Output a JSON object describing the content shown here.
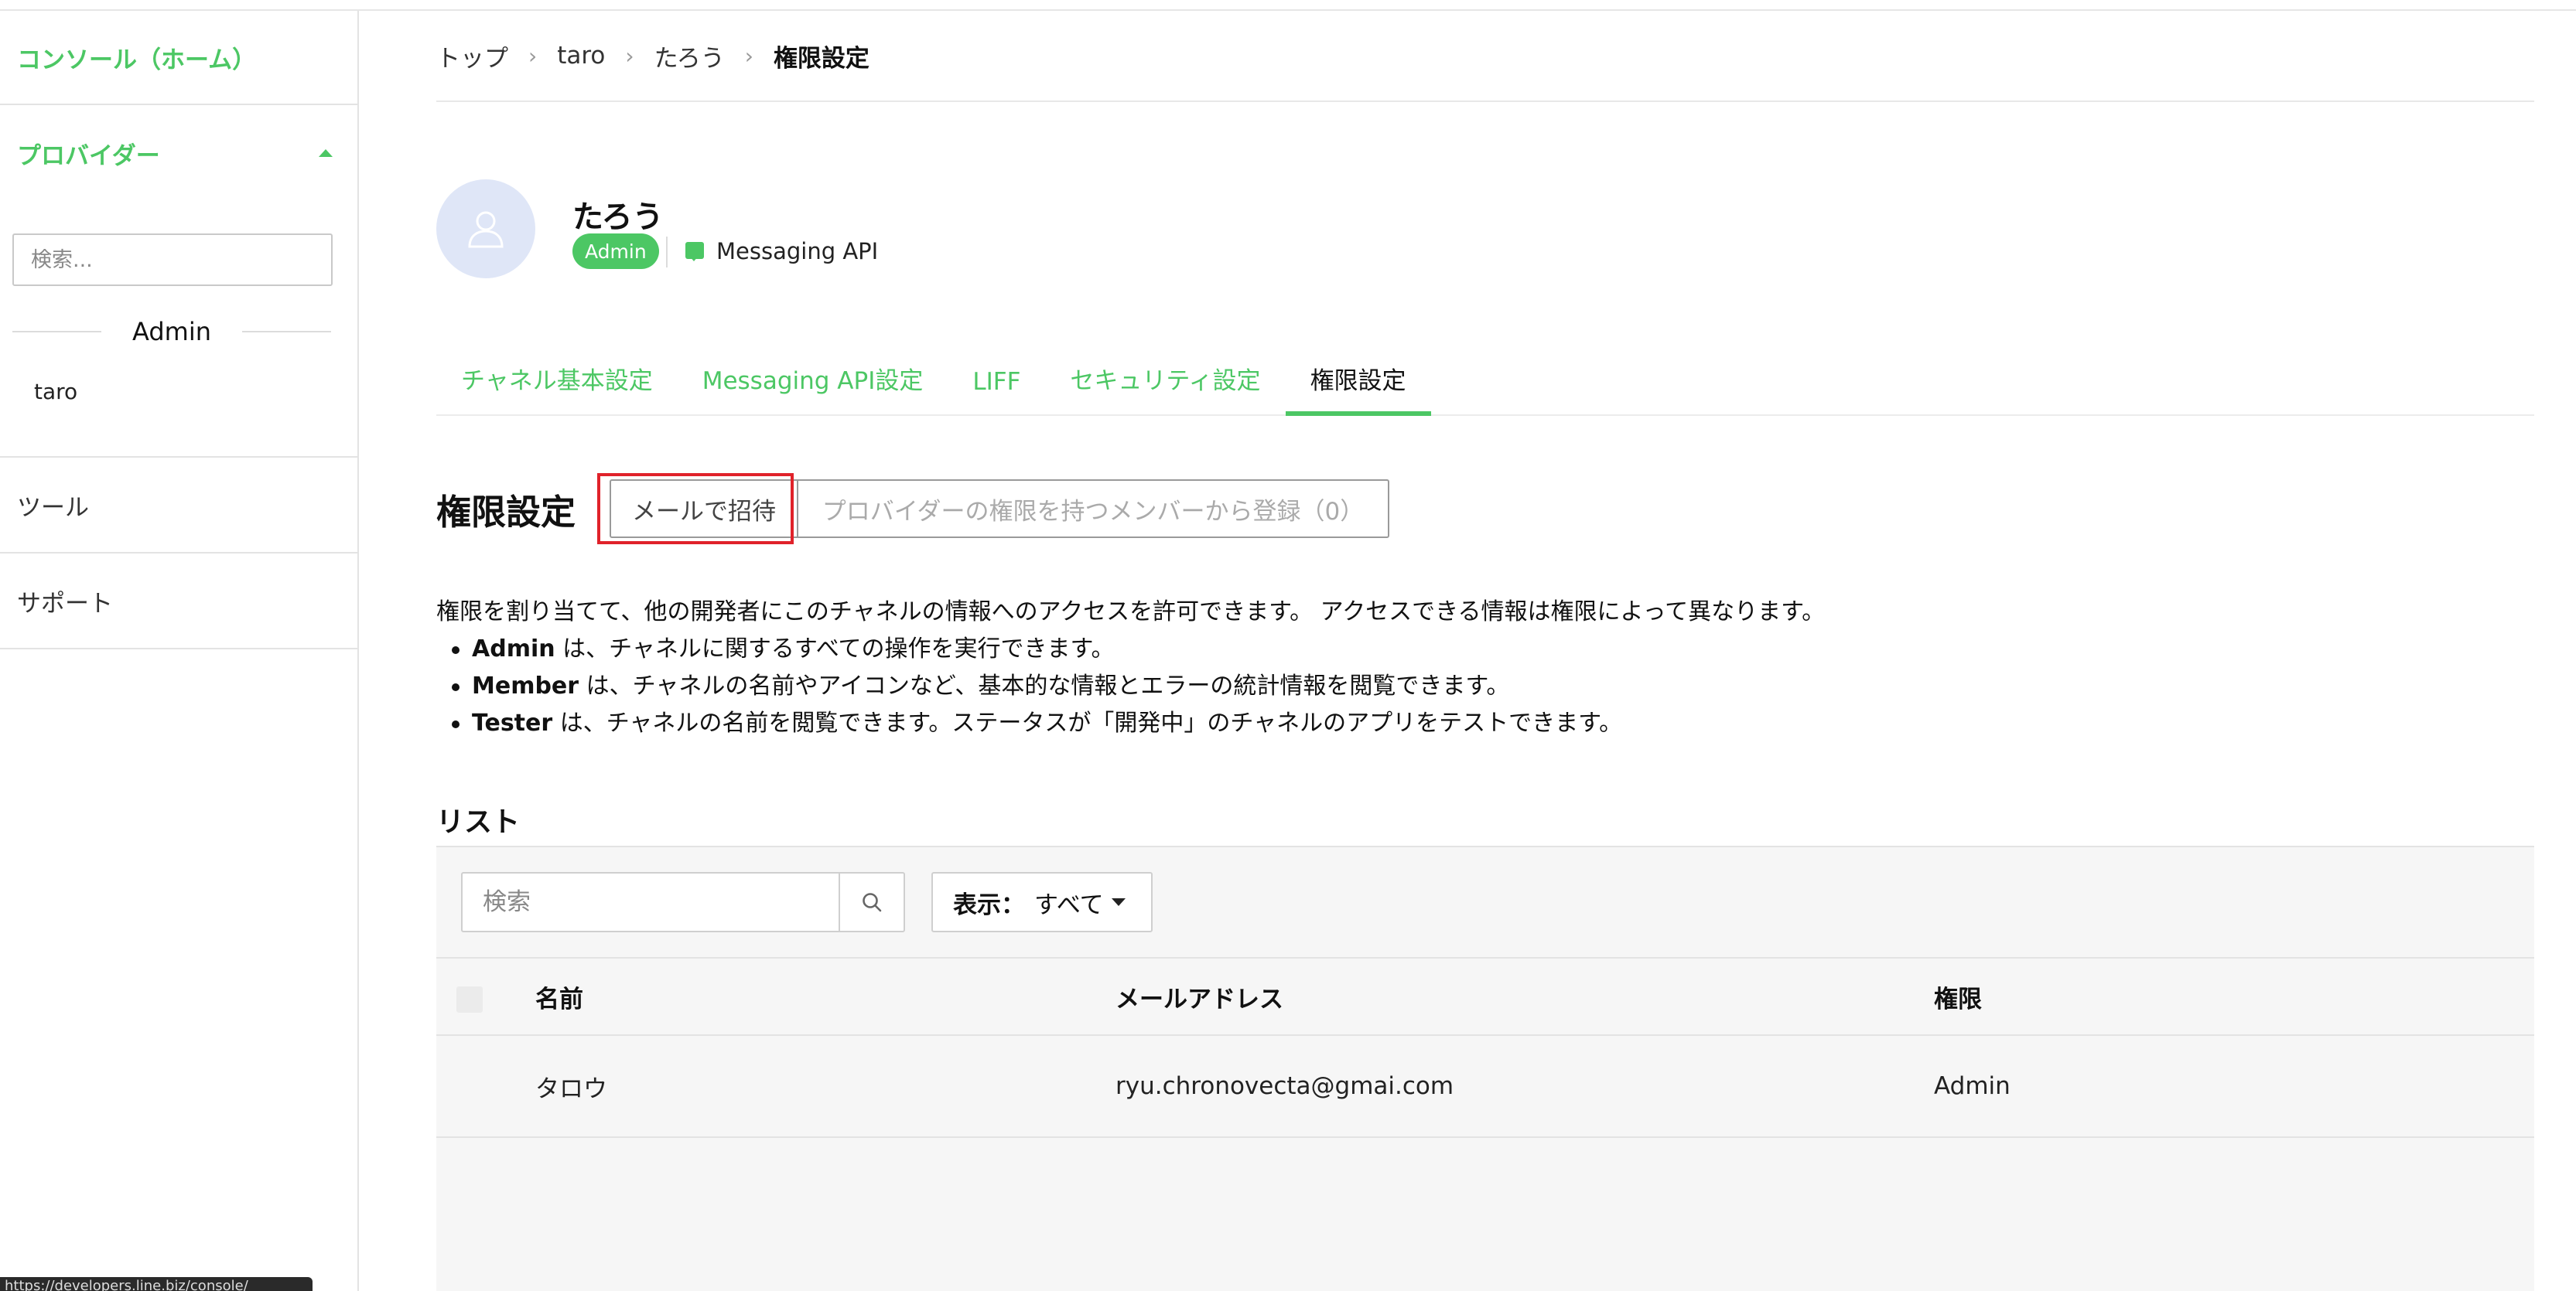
{
  "sidebar": {
    "home_label": "コンソール（ホーム）",
    "provider_label": "プロバイダー",
    "search_placeholder": "検索...",
    "group_label": "Admin",
    "provider_item": "taro",
    "tools_label": "ツール",
    "support_label": "サポート"
  },
  "breadcrumb": {
    "items": [
      "トップ",
      "taro",
      "たろう",
      "権限設定"
    ]
  },
  "channel": {
    "name": "たろう",
    "badge": "Admin",
    "type": "Messaging API"
  },
  "tabs": [
    {
      "label": "チャネル基本設定"
    },
    {
      "label": "Messaging API設定"
    },
    {
      "label": "LIFF"
    },
    {
      "label": "セキュリティ設定"
    },
    {
      "label": "権限設定"
    }
  ],
  "permissions": {
    "title": "権限設定",
    "invite_button": "メールで招待",
    "register_button": "プロバイダーの権限を持つメンバーから登録（0）",
    "description": "権限を割り当てて、他の開発者にこのチャネルの情報へのアクセスを許可できます。 アクセスできる情報は権限によって異なります。",
    "roles": [
      {
        "name": "Admin",
        "text": " は、チャネルに関するすべての操作を実行できます。"
      },
      {
        "name": "Member",
        "text": " は、チャネルの名前やアイコンなど、基本的な情報とエラーの統計情報を閲覧できます。"
      },
      {
        "name": "Tester",
        "text": " は、チャネルの名前を閲覧できます。ステータスが「開発中」のチャネルのアプリをテストできます。"
      }
    ]
  },
  "list": {
    "title": "リスト",
    "search_placeholder": "検索",
    "display_label": "表示：",
    "display_value": "すべて",
    "columns": {
      "name": "名前",
      "email": "メールアドレス",
      "permission": "権限"
    },
    "rows": [
      {
        "name": "タロウ",
        "email": "ryu.chronovecta@gmai.com",
        "permission": "Admin"
      }
    ]
  },
  "status_bar": {
    "url": "https://developers.line.biz/console/"
  },
  "colors": {
    "accent": "#4cc764",
    "highlight": "#e0222a"
  }
}
